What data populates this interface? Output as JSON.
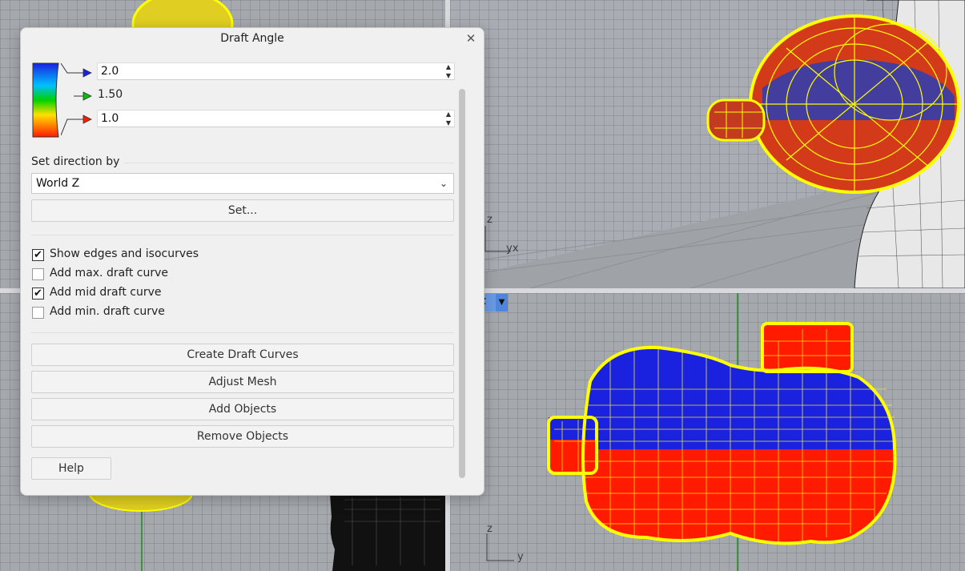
{
  "dialog": {
    "title": "Draft Angle",
    "close_glyph": "✕",
    "upper_value": "2.0",
    "mid_value": "1.50",
    "lower_value": "1.0",
    "direction_label": "Set direction by",
    "direction_selected": "World Z",
    "set_button": "Set...",
    "checkboxes": [
      {
        "label": "Show edges and isocurves",
        "checked": true
      },
      {
        "label": "Add max. draft curve",
        "checked": false
      },
      {
        "label": "Add mid draft curve",
        "checked": true
      },
      {
        "label": "Add min. draft curve",
        "checked": false
      }
    ],
    "buttons": {
      "create": "Create Draft Curves",
      "adjust": "Adjust Mesh",
      "add": "Add Objects",
      "remove": "Remove Objects",
      "help": "Help"
    }
  },
  "viewports": {
    "top_right_axes": {
      "z": "z",
      "yx": "yx"
    },
    "bottom_right_axes": {
      "z": "z",
      "y": "y"
    },
    "bottom_right_tab_fragment": "t"
  },
  "colors": {
    "mesh_yellow": "#ffff00",
    "draft_red": "#ff1a00",
    "draft_blue": "#1a22e0",
    "draft_green": "#00c000"
  },
  "icons": [
    "close-icon",
    "color-gradient-legend",
    "arrow-right-icon",
    "chevron-down-icon",
    "checkmark-icon",
    "spin-up-icon",
    "spin-down-icon"
  ]
}
